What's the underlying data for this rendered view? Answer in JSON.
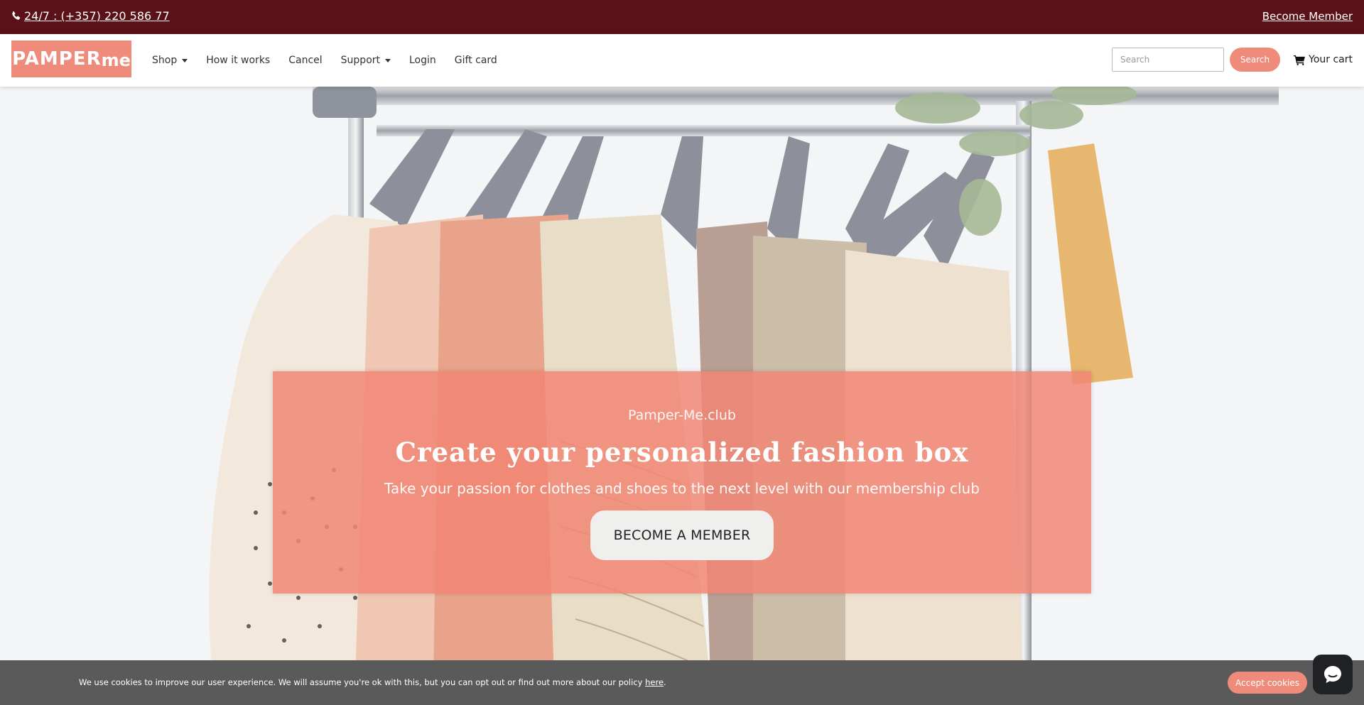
{
  "topbar": {
    "phone": " 24/7 : (+357) 220 586 77",
    "become_member": "Become Member"
  },
  "nav": {
    "logo": {
      "part1": "PAMPER",
      "part2": "me"
    },
    "items": [
      {
        "label": "Shop",
        "has_dropdown": true
      },
      {
        "label": "How it works",
        "has_dropdown": false
      },
      {
        "label": "Cancel",
        "has_dropdown": false
      },
      {
        "label": "Support",
        "has_dropdown": true
      },
      {
        "label": "Login",
        "has_dropdown": false
      },
      {
        "label": "Gift card",
        "has_dropdown": false
      }
    ],
    "search_placeholder": "Search",
    "search_button": "Search",
    "cart": "Your cart"
  },
  "hero": {
    "site_name": "Pamper-Me.club",
    "headline": "Create your personalized fashion box",
    "subtitle": "Take your passion for clothes and shoes to the next level with our membership club",
    "cta": "BECOME A MEMBER"
  },
  "cookie": {
    "message": "We use cookies to improve our user experience. We will assume you're ok with this, but you can opt out or find out more about our policy ",
    "link": "here",
    "after": ".",
    "accept": "Accept cookies"
  },
  "colors": {
    "topbar": "#5b1216",
    "accent": "#ee8b7b",
    "hero_overlay": "#f18673",
    "cookie_bar": "#5a5a5a"
  },
  "icons": [
    "phone-icon",
    "shopping-cart-icon",
    "chat-icon"
  ]
}
